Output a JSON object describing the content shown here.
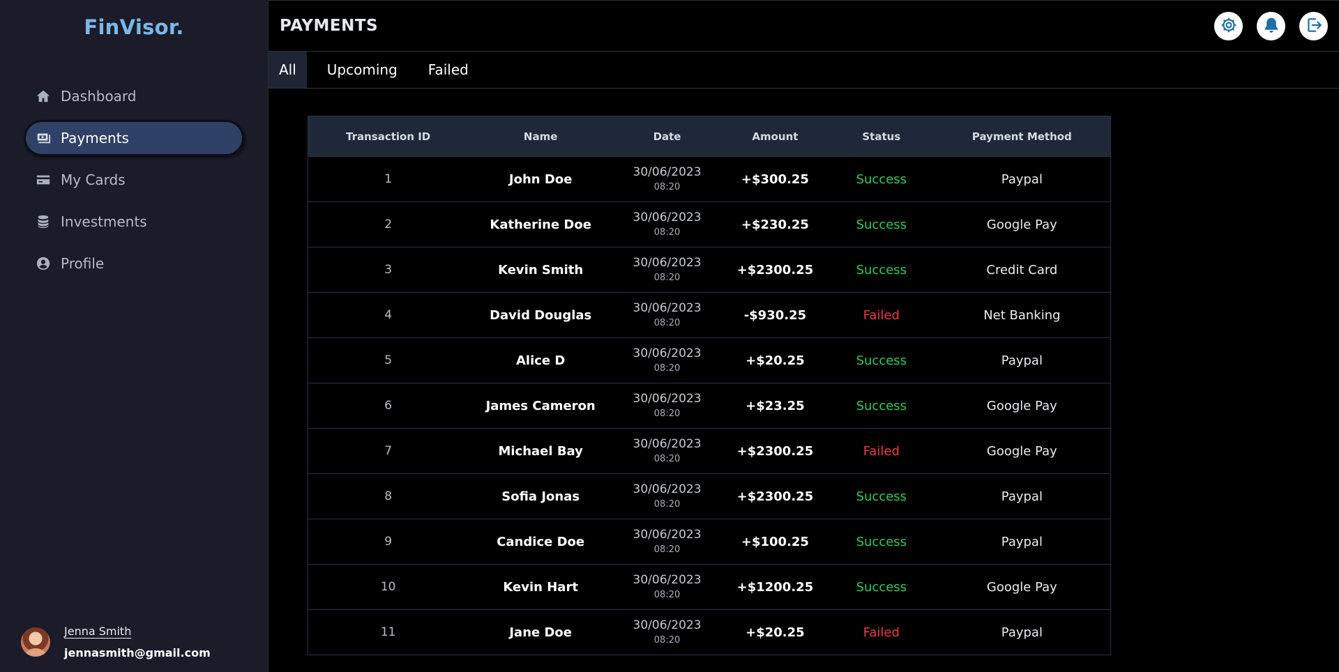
{
  "brand": {
    "logo": "FinVisor."
  },
  "sidebar": {
    "items": [
      {
        "label": "Dashboard",
        "icon": "home-icon",
        "active": false
      },
      {
        "label": "Payments",
        "icon": "payments-icon",
        "active": true
      },
      {
        "label": "My Cards",
        "icon": "card-icon",
        "active": false
      },
      {
        "label": "Investments",
        "icon": "coins-icon",
        "active": false
      },
      {
        "label": "Profile",
        "icon": "user-circle-icon",
        "active": false
      }
    ]
  },
  "user": {
    "name": "Jenna Smith",
    "email": "jennasmith@gmail.com"
  },
  "header": {
    "title": "PAYMENTS",
    "actions": [
      "settings-icon",
      "bell-icon",
      "logout-icon"
    ]
  },
  "tabs": [
    {
      "label": "All",
      "active": true
    },
    {
      "label": "Upcoming",
      "active": false
    },
    {
      "label": "Failed",
      "active": false
    }
  ],
  "table": {
    "columns": [
      "Transaction ID",
      "Name",
      "Date",
      "Amount",
      "Status",
      "Payment Method"
    ],
    "rows": [
      {
        "id": "1",
        "name": "John Doe",
        "date": "30/06/2023",
        "time": "08:20",
        "amount": "+$300.25",
        "status": "Success",
        "method": "Paypal"
      },
      {
        "id": "2",
        "name": "Katherine Doe",
        "date": "30/06/2023",
        "time": "08:20",
        "amount": "+$230.25",
        "status": "Success",
        "method": "Google Pay"
      },
      {
        "id": "3",
        "name": "Kevin Smith",
        "date": "30/06/2023",
        "time": "08:20",
        "amount": "+$2300.25",
        "status": "Success",
        "method": "Credit Card"
      },
      {
        "id": "4",
        "name": "David Douglas",
        "date": "30/06/2023",
        "time": "08:20",
        "amount": "-$930.25",
        "status": "Failed",
        "method": "Net Banking"
      },
      {
        "id": "5",
        "name": "Alice D",
        "date": "30/06/2023",
        "time": "08:20",
        "amount": "+$20.25",
        "status": "Success",
        "method": "Paypal"
      },
      {
        "id": "6",
        "name": "James Cameron",
        "date": "30/06/2023",
        "time": "08:20",
        "amount": "+$23.25",
        "status": "Success",
        "method": "Google Pay"
      },
      {
        "id": "7",
        "name": "Michael Bay",
        "date": "30/06/2023",
        "time": "08:20",
        "amount": "+$2300.25",
        "status": "Failed",
        "method": "Google Pay"
      },
      {
        "id": "8",
        "name": "Sofia Jonas",
        "date": "30/06/2023",
        "time": "08:20",
        "amount": "+$2300.25",
        "status": "Success",
        "method": "Paypal"
      },
      {
        "id": "9",
        "name": "Candice Doe",
        "date": "30/06/2023",
        "time": "08:20",
        "amount": "+$100.25",
        "status": "Success",
        "method": "Paypal"
      },
      {
        "id": "10",
        "name": "Kevin Hart",
        "date": "30/06/2023",
        "time": "08:20",
        "amount": "+$1200.25",
        "status": "Success",
        "method": "Google Pay"
      },
      {
        "id": "11",
        "name": "Jane Doe",
        "date": "30/06/2023",
        "time": "08:20",
        "amount": "+$20.25",
        "status": "Failed",
        "method": "Paypal"
      }
    ]
  },
  "colors": {
    "sidebar_bg": "#1b1b2a",
    "active_nav": "#2f4166",
    "logo": "#7ab8e6",
    "success": "#2ecc5c",
    "failed": "#f23a44",
    "icon_accent": "#1d6fa8"
  }
}
